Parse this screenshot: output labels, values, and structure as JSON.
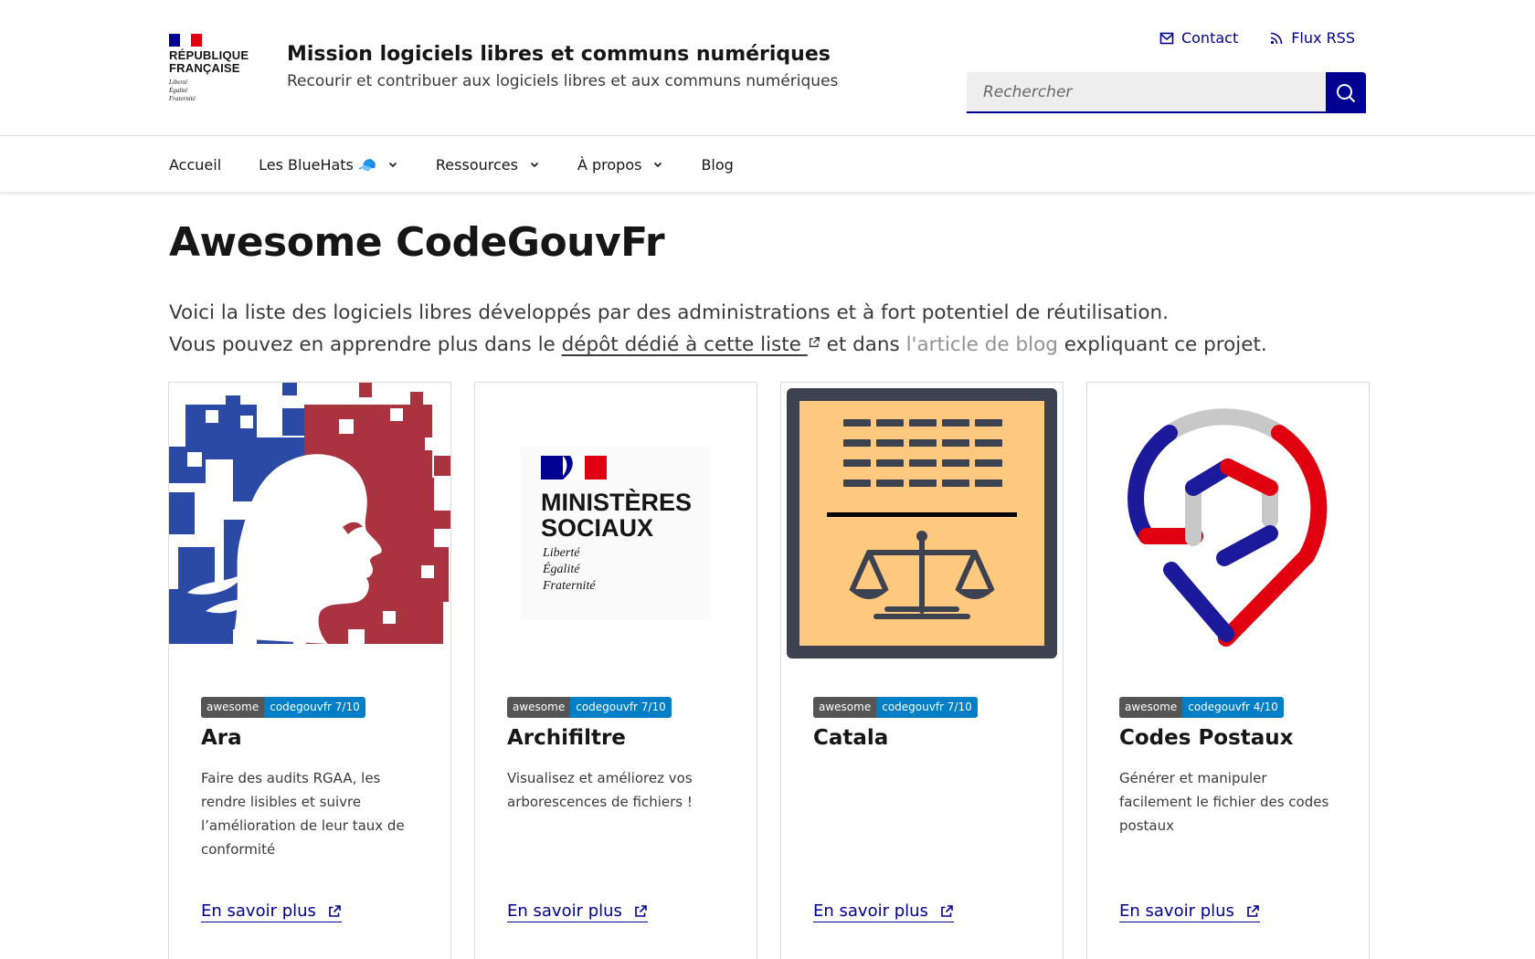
{
  "header": {
    "brand_lines": [
      "RÉPUBLIQUE",
      "FRANÇAISE"
    ],
    "brand_motto": [
      "Liberté",
      "Égalité",
      "Fraternité"
    ],
    "site_title": "Mission logiciels libres et communs numériques",
    "tagline": "Recourir et contribuer aux logiciels libres et aux communs numériques",
    "tools": [
      {
        "label": "Contact",
        "icon": "mail-icon"
      },
      {
        "label": "Flux RSS",
        "icon": "rss-icon"
      }
    ],
    "search_placeholder": "Rechercher"
  },
  "nav": {
    "items": [
      {
        "label": "Accueil",
        "dropdown": false
      },
      {
        "label": "Les BlueHats 🧢",
        "dropdown": true
      },
      {
        "label": "Ressources",
        "dropdown": true
      },
      {
        "label": "À propos",
        "dropdown": true
      },
      {
        "label": "Blog",
        "dropdown": false
      }
    ]
  },
  "main": {
    "title": "Awesome CodeGouvFr",
    "intro_line1": "Voici la liste des logiciels libres développés par des administrations et à fort potentiel de réutilisation.",
    "intro_line2_pre": "Vous pouvez en apprendre plus dans le ",
    "intro_link1": "dépôt dédié à cette liste",
    "intro_line2_mid": " et dans ",
    "intro_link2": "l'article de blog",
    "intro_line2_post": " expliquant ce projet."
  },
  "cards": [
    {
      "badge_left": "awesome",
      "badge_right": "codegouvfr 7/10",
      "title": "Ara",
      "desc": "Faire des audits RGAA, les rendre lisibles et suivre l’amélioration de leur taux de conformité",
      "more": "En savoir plus",
      "image": "marianne-logo"
    },
    {
      "badge_left": "awesome",
      "badge_right": "codegouvfr 7/10",
      "title": "Archifiltre",
      "desc": "Visualisez et améliorez vos arborescences de fichiers !",
      "more": "En savoir plus",
      "image": "ministeres-sociaux-logo",
      "logo_text": [
        "MINISTÈRES",
        "SOCIAUX"
      ],
      "logo_motto": [
        "Liberté",
        "Égalité",
        "Fraternité"
      ]
    },
    {
      "badge_left": "awesome",
      "badge_right": "codegouvfr 7/10",
      "title": "Catala",
      "desc": "",
      "more": "En savoir plus",
      "image": "scales-of-justice-logo"
    },
    {
      "badge_left": "awesome",
      "badge_right": "codegouvfr 4/10",
      "title": "Codes Postaux",
      "desc": "Générer et manipuler facilement le fichier des codes postaux",
      "more": "En savoir plus",
      "image": "map-pin-logo"
    }
  ],
  "colors": {
    "primary": "#000091",
    "flag_blue": "#000091",
    "flag_red": "#e1000f",
    "badge_left": "#555555",
    "badge_right": "#007ec6"
  }
}
